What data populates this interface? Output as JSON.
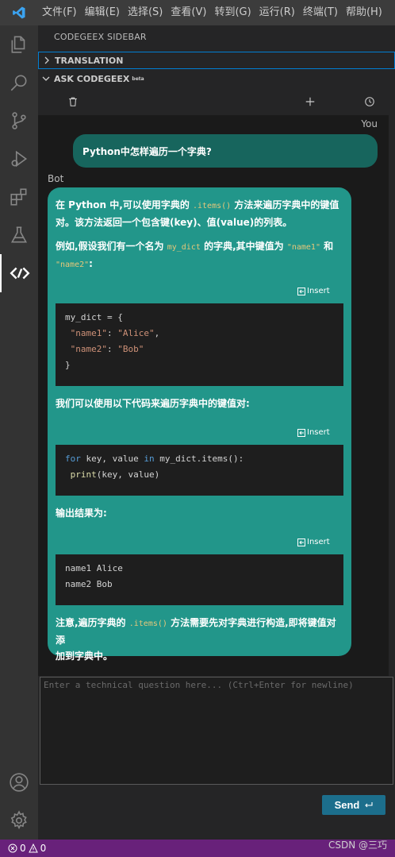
{
  "menubar": {
    "items": [
      "文件(F)",
      "编辑(E)",
      "选择(S)",
      "查看(V)",
      "转到(G)",
      "运行(R)",
      "终端(T)",
      "帮助(H)"
    ]
  },
  "activity_bar": {
    "icons": [
      "files-icon",
      "search-icon",
      "source-control-icon",
      "run-debug-icon",
      "extensions-icon",
      "testing-icon",
      "codegeex-icon",
      "account-icon",
      "settings-gear-icon"
    ]
  },
  "sidebar": {
    "title": "CODEGEEX SIDEBAR",
    "translation_header": "TRANSLATION",
    "ask_header": "ASK CODEGEEX",
    "ask_badge": "beta"
  },
  "chat": {
    "you_label": "You",
    "user_message": "Python中怎样遍历一个字典?",
    "bot_label": "Bot",
    "insert_label": "Insert",
    "p1_a": "在 Python 中,可以使用字典的 ",
    "p1_code": ".items()",
    "p1_b": " 方法来遍历字典中的键值",
    "p1_line2": "对。该方法返回一个包含键(key)、值(value)的列表。",
    "p2_a": "例如,假设我们有一个名为 ",
    "p2_code": "my_dict",
    "p2_b": " 的字典,其中键值为 ",
    "p2_code2": "\"name1\"",
    "p2_c": " 和",
    "p2_code3": "\"name2\"",
    "p2_d": ":",
    "code1_l1": "my_dict = {",
    "code1_l2_key": " \"name1\"",
    "code1_l2_sep": ": ",
    "code1_l2_val": "\"Alice\"",
    "code1_l2_end": ",",
    "code1_l3_key": " \"name2\"",
    "code1_l3_sep": ": ",
    "code1_l3_val": "\"Bob\"",
    "code1_l4": "}",
    "p3": "我们可以使用以下代码来遍历字典中的键值对:",
    "code2_for": "for",
    "code2_mid": " key, value ",
    "code2_in": "in",
    "code2_end": " my_dict.items():",
    "code2_print": " print",
    "code2_args": "(key, value)",
    "p4": "输出结果为:",
    "code3_l1": "name1 Alice",
    "code3_l2": "name2 Bob",
    "p5_a": "注意,遍历字典的 ",
    "p5_code": ".items()",
    "p5_b": " 方法需要先对字典进行构造,即将键值对添",
    "p5_line2": "加到字典中。"
  },
  "input": {
    "placeholder": "Enter a technical question here... (Ctrl+Enter for newline)",
    "send_label": "Send"
  },
  "statusbar": {
    "errors": "0",
    "warnings": "0",
    "watermark": "CSDN @三巧"
  },
  "colors": {
    "accent": "#007acc",
    "user_bubble": "#17655d",
    "bot_bubble": "#22968a",
    "statusbar": "#68217a"
  }
}
